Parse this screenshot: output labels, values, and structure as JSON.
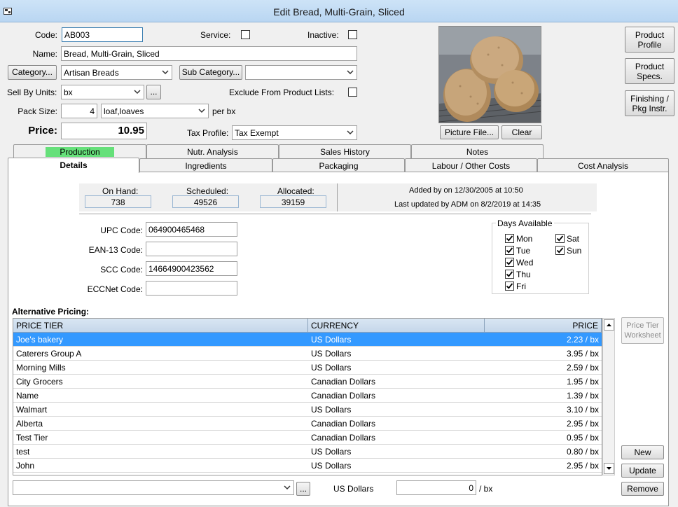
{
  "window": {
    "title": "Edit Bread, Multi-Grain, Sliced"
  },
  "form": {
    "code_label": "Code:",
    "code_value": "AB003",
    "service_label": "Service:",
    "inactive_label": "Inactive:",
    "name_label": "Name:",
    "name_value": "Bread, Multi-Grain, Sliced",
    "category_button": "Category...",
    "category_value": "Artisan Breads",
    "subcategory_button": "Sub Category...",
    "subcategory_value": "",
    "sell_by_units_label": "Sell By Units:",
    "sell_by_units_value": "bx",
    "ellipsis": "...",
    "exclude_label": "Exclude From Product Lists:",
    "pack_size_label": "Pack Size:",
    "pack_size_value": "4",
    "pack_unit_value": "loaf,loaves",
    "per_unit": "per bx",
    "price_label": "Price:",
    "price_value": "10.95",
    "tax_profile_label": "Tax Profile:",
    "tax_profile_value": "Tax Exempt",
    "picture_file_button": "Picture File...",
    "clear_button": "Clear"
  },
  "side_buttons": {
    "product_profile": "Product Profile",
    "product_specs": "Product Specs.",
    "finishing": "Finishing / Pkg Instr."
  },
  "tabs_top": [
    "Production",
    "Nutr. Analysis",
    "Sales History",
    "Notes"
  ],
  "tabs_bottom": [
    "Details",
    "Ingredients",
    "Packaging",
    "Labour / Other Costs",
    "Cost Analysis"
  ],
  "stats": {
    "on_hand_label": "On Hand:",
    "on_hand_value": "738",
    "scheduled_label": "Scheduled:",
    "scheduled_value": "49526",
    "allocated_label": "Allocated:",
    "allocated_value": "39159",
    "added_text": "Added by  on 12/30/2005 at 10:50",
    "updated_text": "Last updated by ADM on 8/2/2019 at 14:35"
  },
  "codes": {
    "upc_label": "UPC Code:",
    "upc_value": "064900465468",
    "ean_label": "EAN-13 Code:",
    "ean_value": "",
    "scc_label": "SCC Code:",
    "scc_value": "14664900423562",
    "eccnet_label": "ECCNet Code:",
    "eccnet_value": ""
  },
  "days_available": {
    "title": "Days Available",
    "days": [
      {
        "label": "Mon",
        "checked": true
      },
      {
        "label": "Tue",
        "checked": true
      },
      {
        "label": "Wed",
        "checked": true
      },
      {
        "label": "Thu",
        "checked": true
      },
      {
        "label": "Fri",
        "checked": true
      },
      {
        "label": "Sat",
        "checked": true
      },
      {
        "label": "Sun",
        "checked": true
      }
    ]
  },
  "pricing": {
    "title": "Alternative Pricing:",
    "columns": [
      "PRICE TIER",
      "CURRENCY",
      "PRICE"
    ],
    "rows": [
      [
        "Joe's bakery",
        "US Dollars",
        "2.23 / bx"
      ],
      [
        "Caterers Group A",
        "US Dollars",
        "3.95 / bx"
      ],
      [
        "Morning Mills",
        "US Dollars",
        "2.59 / bx"
      ],
      [
        "City Grocers",
        "Canadian Dollars",
        "1.95 / bx"
      ],
      [
        "Name",
        "Canadian Dollars",
        "1.39 / bx"
      ],
      [
        "Walmart",
        "US Dollars",
        "3.10 / bx"
      ],
      [
        "Alberta",
        "Canadian Dollars",
        "2.95 / bx"
      ],
      [
        "Test Tier",
        "Canadian Dollars",
        "0.95 / bx"
      ],
      [
        "test",
        "US Dollars",
        "0.80 / bx"
      ],
      [
        "John",
        "US Dollars",
        "2.95 / bx"
      ]
    ],
    "selected_index": 0,
    "tier_worksheet_button": "Price Tier Worksheet",
    "new_button": "New",
    "update_button": "Update",
    "remove_button": "Remove",
    "bottom_currency": "US Dollars",
    "bottom_price": "0",
    "bottom_unit": "/ bx"
  }
}
